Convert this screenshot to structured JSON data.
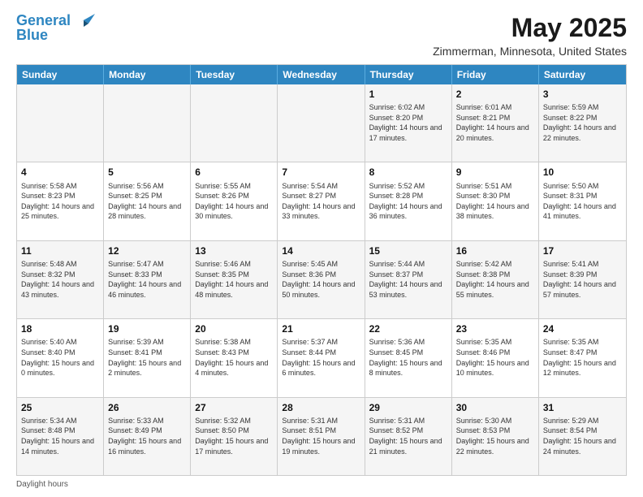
{
  "header": {
    "logo_line1": "General",
    "logo_line2": "Blue",
    "title": "May 2025",
    "subtitle": "Zimmerman, Minnesota, United States"
  },
  "calendar": {
    "days_of_week": [
      "Sunday",
      "Monday",
      "Tuesday",
      "Wednesday",
      "Thursday",
      "Friday",
      "Saturday"
    ],
    "rows": [
      [
        {
          "day": "",
          "empty": true
        },
        {
          "day": "",
          "empty": true
        },
        {
          "day": "",
          "empty": true
        },
        {
          "day": "",
          "empty": true
        },
        {
          "day": "1",
          "sunrise": "Sunrise: 6:02 AM",
          "sunset": "Sunset: 8:20 PM",
          "daylight": "Daylight: 14 hours and 17 minutes."
        },
        {
          "day": "2",
          "sunrise": "Sunrise: 6:01 AM",
          "sunset": "Sunset: 8:21 PM",
          "daylight": "Daylight: 14 hours and 20 minutes."
        },
        {
          "day": "3",
          "sunrise": "Sunrise: 5:59 AM",
          "sunset": "Sunset: 8:22 PM",
          "daylight": "Daylight: 14 hours and 22 minutes."
        }
      ],
      [
        {
          "day": "4",
          "sunrise": "Sunrise: 5:58 AM",
          "sunset": "Sunset: 8:23 PM",
          "daylight": "Daylight: 14 hours and 25 minutes."
        },
        {
          "day": "5",
          "sunrise": "Sunrise: 5:56 AM",
          "sunset": "Sunset: 8:25 PM",
          "daylight": "Daylight: 14 hours and 28 minutes."
        },
        {
          "day": "6",
          "sunrise": "Sunrise: 5:55 AM",
          "sunset": "Sunset: 8:26 PM",
          "daylight": "Daylight: 14 hours and 30 minutes."
        },
        {
          "day": "7",
          "sunrise": "Sunrise: 5:54 AM",
          "sunset": "Sunset: 8:27 PM",
          "daylight": "Daylight: 14 hours and 33 minutes."
        },
        {
          "day": "8",
          "sunrise": "Sunrise: 5:52 AM",
          "sunset": "Sunset: 8:28 PM",
          "daylight": "Daylight: 14 hours and 36 minutes."
        },
        {
          "day": "9",
          "sunrise": "Sunrise: 5:51 AM",
          "sunset": "Sunset: 8:30 PM",
          "daylight": "Daylight: 14 hours and 38 minutes."
        },
        {
          "day": "10",
          "sunrise": "Sunrise: 5:50 AM",
          "sunset": "Sunset: 8:31 PM",
          "daylight": "Daylight: 14 hours and 41 minutes."
        }
      ],
      [
        {
          "day": "11",
          "sunrise": "Sunrise: 5:48 AM",
          "sunset": "Sunset: 8:32 PM",
          "daylight": "Daylight: 14 hours and 43 minutes."
        },
        {
          "day": "12",
          "sunrise": "Sunrise: 5:47 AM",
          "sunset": "Sunset: 8:33 PM",
          "daylight": "Daylight: 14 hours and 46 minutes."
        },
        {
          "day": "13",
          "sunrise": "Sunrise: 5:46 AM",
          "sunset": "Sunset: 8:35 PM",
          "daylight": "Daylight: 14 hours and 48 minutes."
        },
        {
          "day": "14",
          "sunrise": "Sunrise: 5:45 AM",
          "sunset": "Sunset: 8:36 PM",
          "daylight": "Daylight: 14 hours and 50 minutes."
        },
        {
          "day": "15",
          "sunrise": "Sunrise: 5:44 AM",
          "sunset": "Sunset: 8:37 PM",
          "daylight": "Daylight: 14 hours and 53 minutes."
        },
        {
          "day": "16",
          "sunrise": "Sunrise: 5:42 AM",
          "sunset": "Sunset: 8:38 PM",
          "daylight": "Daylight: 14 hours and 55 minutes."
        },
        {
          "day": "17",
          "sunrise": "Sunrise: 5:41 AM",
          "sunset": "Sunset: 8:39 PM",
          "daylight": "Daylight: 14 hours and 57 minutes."
        }
      ],
      [
        {
          "day": "18",
          "sunrise": "Sunrise: 5:40 AM",
          "sunset": "Sunset: 8:40 PM",
          "daylight": "Daylight: 15 hours and 0 minutes."
        },
        {
          "day": "19",
          "sunrise": "Sunrise: 5:39 AM",
          "sunset": "Sunset: 8:41 PM",
          "daylight": "Daylight: 15 hours and 2 minutes."
        },
        {
          "day": "20",
          "sunrise": "Sunrise: 5:38 AM",
          "sunset": "Sunset: 8:43 PM",
          "daylight": "Daylight: 15 hours and 4 minutes."
        },
        {
          "day": "21",
          "sunrise": "Sunrise: 5:37 AM",
          "sunset": "Sunset: 8:44 PM",
          "daylight": "Daylight: 15 hours and 6 minutes."
        },
        {
          "day": "22",
          "sunrise": "Sunrise: 5:36 AM",
          "sunset": "Sunset: 8:45 PM",
          "daylight": "Daylight: 15 hours and 8 minutes."
        },
        {
          "day": "23",
          "sunrise": "Sunrise: 5:35 AM",
          "sunset": "Sunset: 8:46 PM",
          "daylight": "Daylight: 15 hours and 10 minutes."
        },
        {
          "day": "24",
          "sunrise": "Sunrise: 5:35 AM",
          "sunset": "Sunset: 8:47 PM",
          "daylight": "Daylight: 15 hours and 12 minutes."
        }
      ],
      [
        {
          "day": "25",
          "sunrise": "Sunrise: 5:34 AM",
          "sunset": "Sunset: 8:48 PM",
          "daylight": "Daylight: 15 hours and 14 minutes."
        },
        {
          "day": "26",
          "sunrise": "Sunrise: 5:33 AM",
          "sunset": "Sunset: 8:49 PM",
          "daylight": "Daylight: 15 hours and 16 minutes."
        },
        {
          "day": "27",
          "sunrise": "Sunrise: 5:32 AM",
          "sunset": "Sunset: 8:50 PM",
          "daylight": "Daylight: 15 hours and 17 minutes."
        },
        {
          "day": "28",
          "sunrise": "Sunrise: 5:31 AM",
          "sunset": "Sunset: 8:51 PM",
          "daylight": "Daylight: 15 hours and 19 minutes."
        },
        {
          "day": "29",
          "sunrise": "Sunrise: 5:31 AM",
          "sunset": "Sunset: 8:52 PM",
          "daylight": "Daylight: 15 hours and 21 minutes."
        },
        {
          "day": "30",
          "sunrise": "Sunrise: 5:30 AM",
          "sunset": "Sunset: 8:53 PM",
          "daylight": "Daylight: 15 hours and 22 minutes."
        },
        {
          "day": "31",
          "sunrise": "Sunrise: 5:29 AM",
          "sunset": "Sunset: 8:54 PM",
          "daylight": "Daylight: 15 hours and 24 minutes."
        }
      ]
    ]
  },
  "footer": {
    "note": "Daylight hours"
  }
}
